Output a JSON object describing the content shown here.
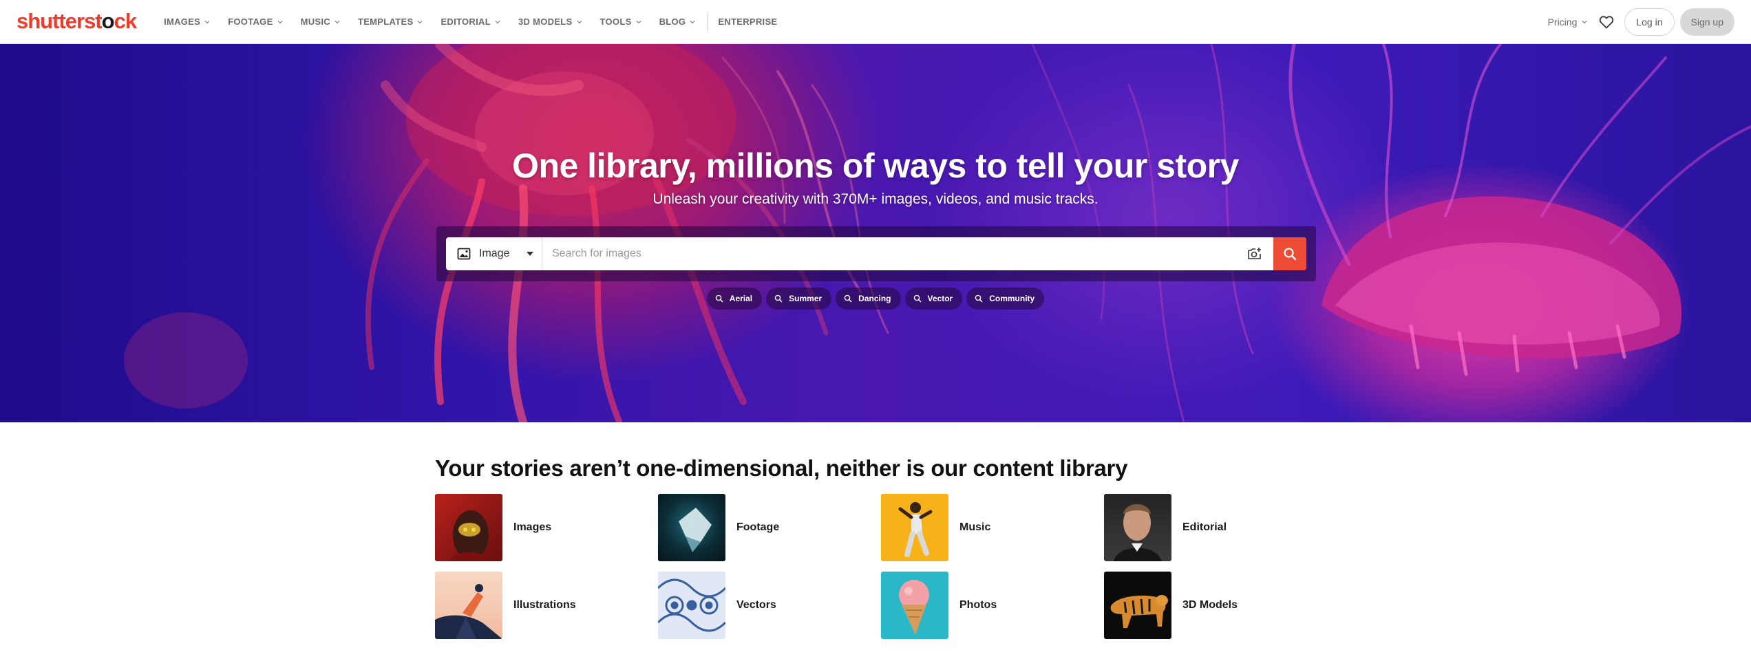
{
  "brand": {
    "logo_main": "shutterst",
    "logo_tail": "ck",
    "logo_o": "o",
    "accent": "#ef3b2c"
  },
  "nav": {
    "items": [
      {
        "label": "IMAGES",
        "dropdown": true
      },
      {
        "label": "FOOTAGE",
        "dropdown": true
      },
      {
        "label": "MUSIC",
        "dropdown": true
      },
      {
        "label": "TEMPLATES",
        "dropdown": true
      },
      {
        "label": "EDITORIAL",
        "dropdown": true
      },
      {
        "label": "3D MODELS",
        "dropdown": true
      },
      {
        "label": "TOOLS",
        "dropdown": true
      },
      {
        "label": "BLOG",
        "dropdown": true
      }
    ],
    "enterprise": "ENTERPRISE",
    "pricing": "Pricing",
    "login": "Log in",
    "signup": "Sign up",
    "heart_icon": "heart-icon"
  },
  "hero": {
    "title": "One library, millions of ways to tell your story",
    "subtitle": "Unleash your creativity with 370M+ images, videos, and music tracks.",
    "search": {
      "type_label": "Image",
      "placeholder": "Search for images",
      "search_button_color": "#ee4b34"
    },
    "chips": [
      "Aerial",
      "Summer",
      "Dancing",
      "Vector",
      "Community"
    ]
  },
  "section": {
    "title": "Your stories aren’t one-dimensional, neither is our content library",
    "categories": [
      {
        "label": "Images"
      },
      {
        "label": "Footage"
      },
      {
        "label": "Music"
      },
      {
        "label": "Editorial"
      },
      {
        "label": "Illustrations"
      },
      {
        "label": "Vectors"
      },
      {
        "label": "Photos"
      },
      {
        "label": "3D Models"
      }
    ]
  }
}
